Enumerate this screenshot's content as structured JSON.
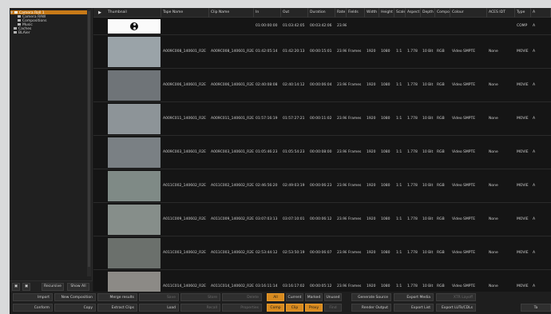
{
  "tree": {
    "items": [
      {
        "label": "Camera Roll 1",
        "expander": "▼",
        "level": 0,
        "selected": true
      },
      {
        "label": "Camera RAW",
        "expander": "",
        "level": 1,
        "selected": false
      },
      {
        "label": "Compositions",
        "expander": "",
        "level": 1,
        "selected": false
      },
      {
        "label": "Music",
        "expander": "",
        "level": 1,
        "selected": false
      },
      {
        "label": "Caches",
        "expander": "",
        "level": 0,
        "selected": false
      },
      {
        "label": "BLAier",
        "expander": "",
        "level": 0,
        "selected": false
      }
    ],
    "recursive_label": "Recursive",
    "show_all_label": "Show All"
  },
  "table": {
    "headers": [
      "Thumbnail",
      "Tape Name",
      "Clip Name",
      "In",
      "Out",
      "Duration",
      "Rate",
      "Fields",
      "Width",
      "Height",
      "Scale",
      "Aspect",
      "Depth",
      "Compone",
      "Colour",
      "ACES IDT",
      "Type",
      "A"
    ],
    "rows": [
      {
        "tape": "",
        "clip": "",
        "in": "01:00:00:00",
        "out": "01:03:42:05",
        "dur": "00:03:42:06",
        "rate": "23.98",
        "fields": "",
        "width": "",
        "height": "",
        "scale": "",
        "aspect": "",
        "depth": "",
        "comp": "",
        "colour": "",
        "aces": "",
        "type": "COMP",
        "a": "A"
      },
      {
        "tape": "A009C008_140601_R2E",
        "clip": "A009C008_140601_R2E",
        "in": "01:42:05:14",
        "out": "01:42:20:13",
        "dur": "00:00:15:01",
        "rate": "23.98",
        "fields": "Frames",
        "width": "1920",
        "height": "1080",
        "scale": "1:1",
        "aspect": "1.778",
        "depth": "10 Bit",
        "comp": "RGB",
        "colour": "Video SMPTE",
        "aces": "None",
        "type": "MOVIE",
        "a": "A"
      },
      {
        "tape": "A009C006_140601_R2E",
        "clip": "A009C006_140601_R2E",
        "in": "02:40:08:08",
        "out": "02:40:14:12",
        "dur": "00:00:06:04",
        "rate": "23.98",
        "fields": "Frames",
        "width": "1920",
        "height": "1080",
        "scale": "1:1",
        "aspect": "1.778",
        "depth": "10 Bit",
        "comp": "RGB",
        "colour": "Video SMPTE",
        "aces": "None",
        "type": "MOVIE",
        "a": "A"
      },
      {
        "tape": "A009C011_140601_R2E",
        "clip": "A009C011_140601_R2E",
        "in": "01:57:16:19",
        "out": "01:57:27:21",
        "dur": "00:00:11:02",
        "rate": "23.98",
        "fields": "Frames",
        "width": "1920",
        "height": "1080",
        "scale": "1:1",
        "aspect": "1.778",
        "depth": "10 Bit",
        "comp": "RGB",
        "colour": "Video SMPTE",
        "aces": "None",
        "type": "MOVIE",
        "a": "A"
      },
      {
        "tape": "A009C003_140601_R2E",
        "clip": "A009C003_140601_R2E",
        "in": "01:05:46:23",
        "out": "01:05:54:23",
        "dur": "00:00:08:00",
        "rate": "23.98",
        "fields": "Frames",
        "width": "1920",
        "height": "1080",
        "scale": "1:1",
        "aspect": "1.778",
        "depth": "10 Bit",
        "comp": "RGB",
        "colour": "Video SMPTE",
        "aces": "None",
        "type": "MOVIE",
        "a": "A"
      },
      {
        "tape": "A011C002_140602_R2E",
        "clip": "A011C002_140602_R2E",
        "in": "02:46:56:20",
        "out": "02:49:03:19",
        "dur": "00:00:06:23",
        "rate": "23.98",
        "fields": "Frames",
        "width": "1920",
        "height": "1080",
        "scale": "1:1",
        "aspect": "1.778",
        "depth": "10 Bit",
        "comp": "RGB",
        "colour": "Video SMPTE",
        "aces": "None",
        "type": "MOVIE",
        "a": "A"
      },
      {
        "tape": "A011C009_140602_R2E",
        "clip": "A011C009_140602_R2E",
        "in": "03:07:03:13",
        "out": "03:07:10:01",
        "dur": "00:00:06:12",
        "rate": "23.98",
        "fields": "Frames",
        "width": "1920",
        "height": "1080",
        "scale": "1:1",
        "aspect": "1.778",
        "depth": "10 Bit",
        "comp": "RGB",
        "colour": "Video SMPTE",
        "aces": "None",
        "type": "MOVIE",
        "a": "A"
      },
      {
        "tape": "A011C003_140602_R2E",
        "clip": "A011C003_140602_R2E",
        "in": "02:53:44:12",
        "out": "02:53:50:19",
        "dur": "00:00:06:07",
        "rate": "23.98",
        "fields": "Frames",
        "width": "1920",
        "height": "1080",
        "scale": "1:1",
        "aspect": "1.778",
        "depth": "10 Bit",
        "comp": "RGB",
        "colour": "Video SMPTE",
        "aces": "None",
        "type": "MOVIE",
        "a": "A"
      },
      {
        "tape": "A011C014_140602_R2E",
        "clip": "A011C014_140602_R2E",
        "in": "03:16:11:14",
        "out": "03:16:17:02",
        "dur": "00:00:05:12",
        "rate": "23.98",
        "fields": "Frames",
        "width": "1920",
        "height": "1080",
        "scale": "1:1",
        "aspect": "1.778",
        "depth": "10 Bit",
        "comp": "RGB",
        "colour": "Video SMPTE",
        "aces": "None",
        "type": "MOVIE",
        "a": "A"
      }
    ],
    "thumb_colors": [
      "#fafafa",
      "#9aa3a8",
      "#6f7478",
      "#8d9498",
      "#7a8084",
      "#7f8a86",
      "#868e8a",
      "#6b706c",
      "#8c8a86"
    ]
  },
  "buttons": {
    "import": "Import",
    "new_composition": "New Composition",
    "merge_results": "Merge results",
    "save": "Save",
    "store": "Store",
    "delete": "Delete",
    "all": "All",
    "current": "Current",
    "marked": "Marked",
    "unused": "Unused",
    "generate_source": "Generate Source",
    "export_media": "Export Media",
    "xtr_layoff": "XTR Layoff",
    "conform": "Conform",
    "copy": "Copy",
    "extract_clips": "Extract Clips",
    "load": "Load",
    "recall": "Recall",
    "properties": "Properties",
    "comp": "Comp",
    "clip": "Clip",
    "proxy": "Proxy",
    "find": "Find",
    "render_output": "Render Output",
    "export_list": "Export List",
    "export_luts": "Export LUTs/CDLs",
    "ta": "Ta"
  }
}
